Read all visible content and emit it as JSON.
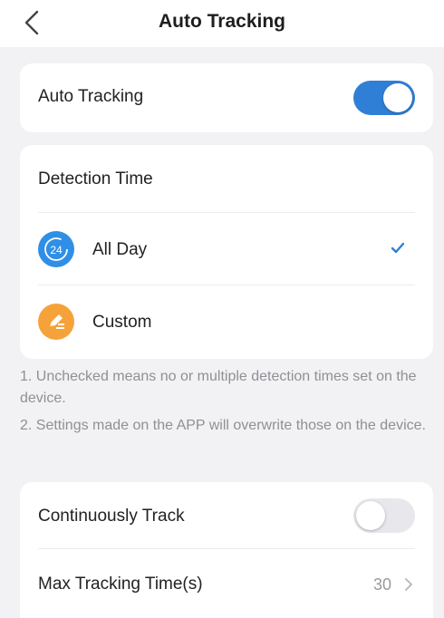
{
  "header": {
    "title": "Auto Tracking"
  },
  "auto_tracking": {
    "label": "Auto Tracking",
    "enabled": true
  },
  "detection": {
    "heading": "Detection Time",
    "options": [
      {
        "label": "All Day",
        "icon": "24-hour-icon",
        "icon_text": "24",
        "selected": true,
        "color": "#2f8fe6"
      },
      {
        "label": "Custom",
        "icon": "edit-pen-icon",
        "selected": false,
        "color": "#f6a23a"
      }
    ]
  },
  "notes": [
    "1. Unchecked means no or multiple detection times set on the device.",
    "2. Settings made on the APP will overwrite those on the device."
  ],
  "tracking": {
    "continuous": {
      "label": "Continuously Track",
      "enabled": false
    },
    "max_time": {
      "label": "Max Tracking Time(s)",
      "value": "30"
    }
  },
  "colors": {
    "accent": "#2f7fd6",
    "background": "#f2f2f5"
  }
}
